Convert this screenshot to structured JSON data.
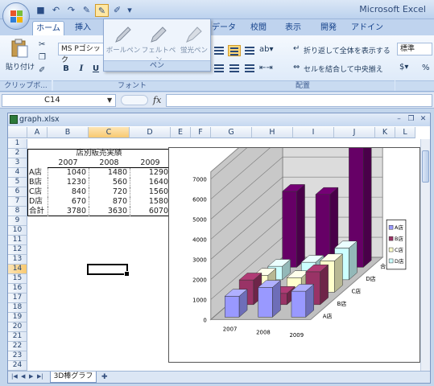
{
  "app": {
    "title": "Microsoft Excel"
  },
  "ribbon_tabs": [
    "ホーム",
    "挿入",
    "データ",
    "校閲",
    "表示",
    "開発",
    "アドイン"
  ],
  "pen_menu": {
    "items": [
      "ボールペン",
      "フェルトペン",
      "蛍光ペン"
    ],
    "caption": "ペン"
  },
  "ribbon": {
    "paste_label": "貼り付け",
    "clipboard_label": "クリップボ...",
    "font_name": "MS Pゴシック",
    "font_label": "フォント",
    "wrap_text": "折り返して全体を表示する",
    "merge_center": "セルを結合して中央揃え",
    "alignment_label": "配置",
    "number_format": "標準",
    "percent": "%"
  },
  "formula_bar": {
    "name_box": "C14",
    "fx": "fx",
    "formula": ""
  },
  "workbook": {
    "title": "graph.xlsx",
    "columns": [
      "A",
      "B",
      "C",
      "D",
      "E",
      "F",
      "G",
      "H",
      "I",
      "J",
      "K",
      "L"
    ],
    "rows": [
      "1",
      "2",
      "3",
      "4",
      "5",
      "6",
      "7",
      "8",
      "9",
      "10",
      "11",
      "12",
      "13",
      "14",
      "15",
      "16",
      "17",
      "18",
      "19",
      "20",
      "21",
      "22",
      "23",
      "24"
    ],
    "table_title": "店別販売実績",
    "years": [
      "2007",
      "2008",
      "2009"
    ],
    "table_rows": [
      {
        "store": "A店",
        "values": [
          "1040",
          "1480",
          "1290"
        ]
      },
      {
        "store": "B店",
        "values": [
          "1230",
          "560",
          "1640"
        ]
      },
      {
        "store": "C店",
        "values": [
          "840",
          "720",
          "1560"
        ]
      },
      {
        "store": "D店",
        "values": [
          "670",
          "870",
          "1580"
        ]
      },
      {
        "store": "合計",
        "values": [
          "3780",
          "3630",
          "6070"
        ]
      }
    ],
    "sheet_tab": "3D棒グラフ"
  },
  "chart_data": {
    "type": "bar",
    "subtype": "3d-column",
    "categories": [
      "2007",
      "2008",
      "2009"
    ],
    "series": [
      {
        "name": "A店",
        "values": [
          1040,
          1480,
          1290
        ],
        "color": "#9999ff"
      },
      {
        "name": "B店",
        "values": [
          1230,
          560,
          1640
        ],
        "color": "#993366"
      },
      {
        "name": "C店",
        "values": [
          840,
          720,
          1560
        ],
        "color": "#ffffcc"
      },
      {
        "name": "D店",
        "values": [
          670,
          870,
          1580
        ],
        "color": "#ccffff"
      },
      {
        "name": "合計",
        "values": [
          3780,
          3630,
          6070
        ],
        "color": "#660066"
      }
    ],
    "y_ticks": [
      "0",
      "1000",
      "2000",
      "3000",
      "4000",
      "5000",
      "6000",
      "7000"
    ],
    "ylim": [
      0,
      7000
    ],
    "depth_labels": [
      "A店",
      "B店",
      "C店",
      "D店",
      "合計"
    ],
    "legend": [
      "A店",
      "B店",
      "C店",
      "D店"
    ],
    "legend_position": "right"
  }
}
